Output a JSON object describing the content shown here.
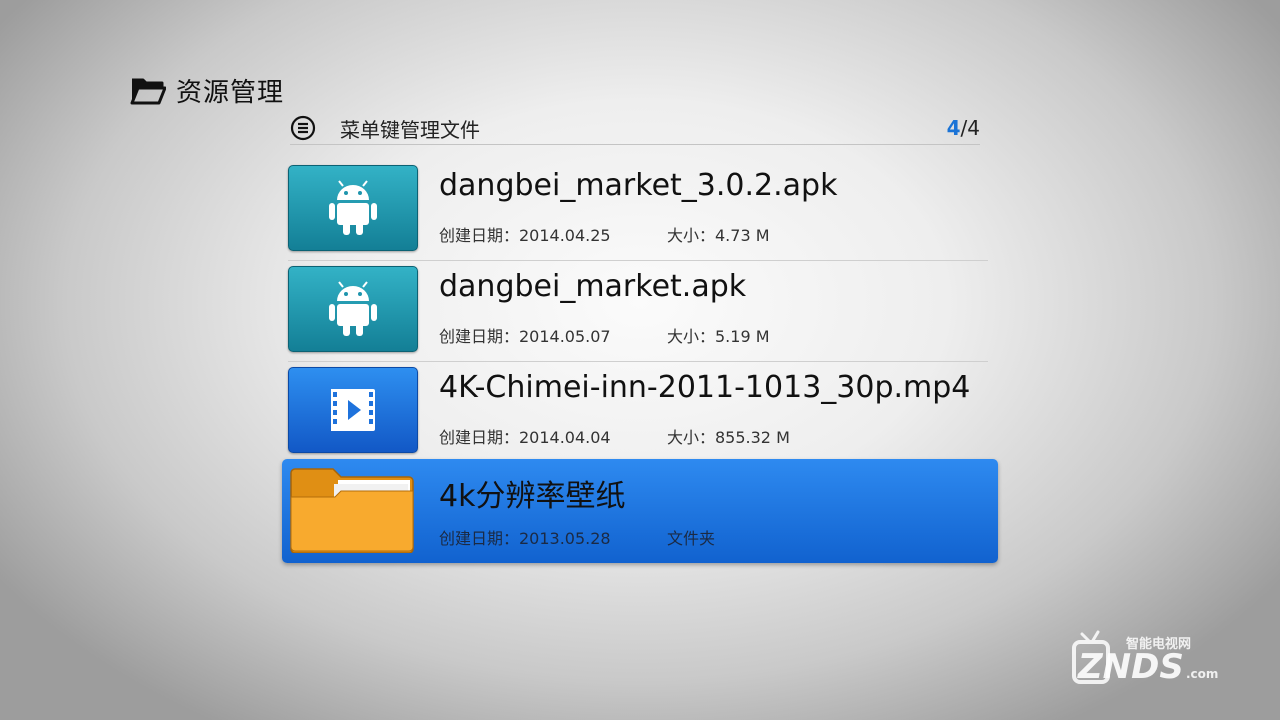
{
  "header": {
    "title": "资源管理",
    "icon": "folder-open-icon"
  },
  "subbar": {
    "hint": "菜单键管理文件",
    "page_current": "4",
    "page_total": "/4",
    "icon": "menu-circle-icon"
  },
  "files": [
    {
      "name": "dangbei_market_3.0.2.apk",
      "date": "创建日期：2014.04.25",
      "size": "大小：4.73 M",
      "type": "apk",
      "icon": "android-icon"
    },
    {
      "name": "dangbei_market.apk",
      "date": "创建日期：2014.05.07",
      "size": "大小：5.19 M",
      "type": "apk",
      "icon": "android-icon"
    },
    {
      "name": "4K-Chimei-inn-2011-1013_30p.mp4",
      "date": "创建日期：2014.04.04",
      "size": "大小：855.32 M",
      "type": "video",
      "icon": "video-play-icon"
    },
    {
      "name": "4k分辨率壁纸",
      "date": "创建日期：2013.05.28",
      "size": "文件夹",
      "type": "folder",
      "icon": "folder-icon",
      "selected": true
    }
  ],
  "watermark": {
    "top": "智能电视网",
    "brand": "ZNDS",
    "suffix": ".com"
  },
  "colors": {
    "accent": "#1a73d6",
    "selection": "#1e78e6",
    "apk": "#1f95ad",
    "video": "#1e72dc",
    "folder": "#f5a623"
  }
}
